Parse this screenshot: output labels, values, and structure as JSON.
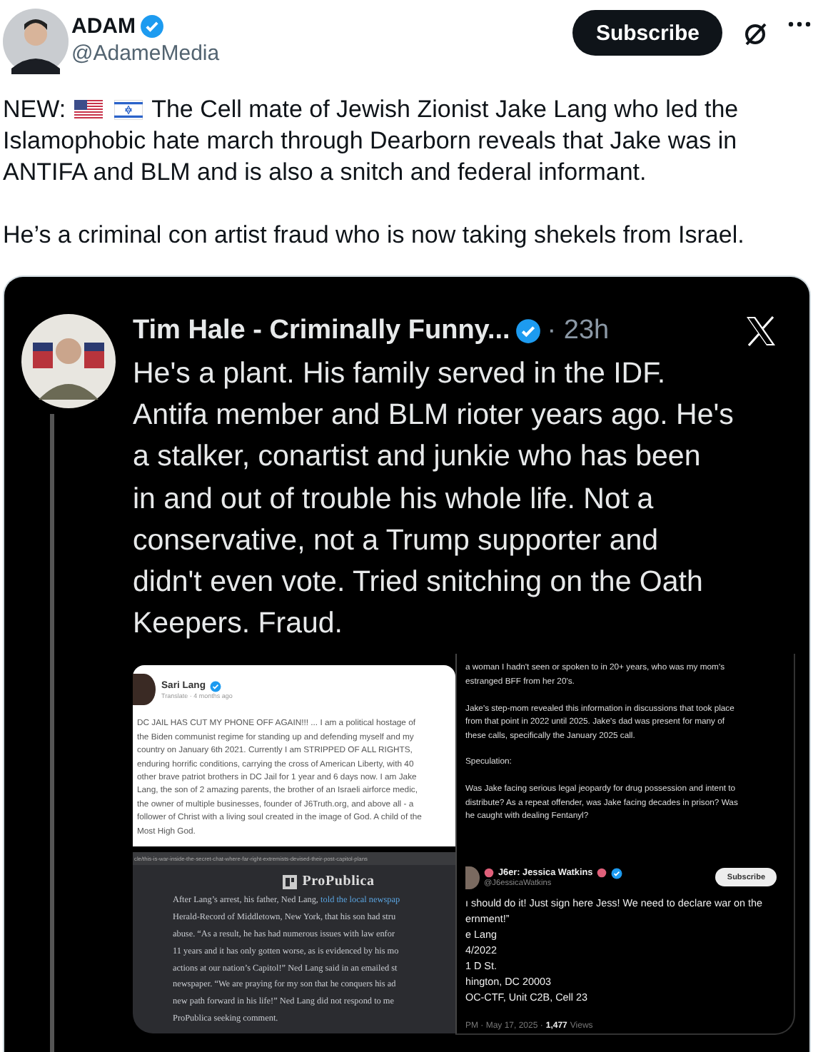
{
  "post": {
    "author": {
      "name": "ADAM",
      "handle": "@AdameMedia",
      "verified": true
    },
    "subscribe_label": "Subscribe",
    "intro": {
      "lead": "NEW:",
      "first_line": "The Cell mate of Jewish Zionist Jake Lang who led the",
      "text": "Islamophobic hate march through Dearborn reveals that Jake was in ANTIFA and BLM and is also a snitch and federal informant."
    },
    "paragraph": "He’s a criminal con artist fraud who is now taking shekels from Israel."
  },
  "media": {
    "quoted": {
      "name": "Tim Hale - Criminally Funny...",
      "verified": true,
      "time": "· 23h",
      "lines": [
        "He's a plant. His family served in the IDF.",
        "Antifa member and BLM rioter years ago. He's",
        "a stalker, conartist and junkie who has been",
        "in and out of trouble his whole life. Not a",
        "conservative, not a Trump supporter and",
        "didn't even vote. Tried snitching on the Oath",
        "Keepers. Fraud."
      ]
    },
    "facebook_post": {
      "name": "Sari Lang",
      "verified": true,
      "meta": "Translate · 4 months ago",
      "lines": [
        "DC JAIL HAS CUT MY PHONE OFF AGAIN!!! ... I am a political hostage of",
        "the Biden communist regime for standing up and defending myself and my",
        "country on January 6th 2021. Currently I am STRIPPED OF ALL RIGHTS,",
        "enduring horrific conditions, carrying the cross of American Liberty, with 40",
        "other brave patriot brothers in DC Jail for 1 year and 6 days now. I am Jake",
        "Lang, the son of 2 amazing parents, the brother of an Israeli airforce medic,",
        "the owner of multiple businesses, founder of J6Truth.org, and above all - a",
        "follower of Christ with a living soul created in the image of God. A child of the",
        "Most High God."
      ]
    },
    "url_caption": "cle/this-is-war-inside-the-secret-chat-where-far-right-extremists-devised-their-post-capitol-plans",
    "article": {
      "brand": "ProPublica",
      "lines": [
        {
          "text": "After Lang’s arrest, his father, Ned Lang, ",
          "link": "told the local newspap"
        },
        {
          "text": "Herald-Record of Middletown, New York, that his son had stru"
        },
        {
          "text": "abuse. “As a result, he has had numerous issues with law enfor"
        },
        {
          "text": "11 years and it has only gotten worse, as is evidenced by his mo"
        },
        {
          "text": "actions at our nation’s Capitol!” Ned Lang said in an emailed st"
        },
        {
          "text": "newspaper. “We are praying for my son that he conquers his ad"
        },
        {
          "text": "new path forward in his life!” Ned Lang did not respond to me"
        },
        {
          "text": "ProPublica seeking comment."
        }
      ]
    },
    "notes": {
      "paragraphs": [
        [
          "a woman I hadn't seen or spoken to in 20+ years, who was my mom's",
          "estranged BFF from her 20's."
        ],
        [
          "Jake's step-mom revealed this information in discussions that took place",
          "from that point in 2022 until 2025. Jake's dad was present for many of",
          "these calls, specifically the January 2025 call."
        ],
        [
          "Speculation:"
        ],
        [
          "Was Jake facing serious legal jeopardy for drug possession and intent to",
          "distribute? As a repeat offender, was Jake facing decades in prison? Was",
          "he caught with dealing Fentanyl?"
        ]
      ]
    },
    "embedded_post": {
      "name": "J6er: Jessica Watkins",
      "verified": true,
      "handle": "@J6essicaWatkins",
      "subscribe_label": "Subscribe",
      "lines": [
        "ı should do it! Just sign here Jess! We need to declare war on the",
        "ernment!”",
        "e Lang",
        "4/2022",
        "1 D St.",
        "hington, DC 20003",
        "OC-CTF, Unit C2B, Cell 23"
      ],
      "time": "PM · May 17, 2025 ·",
      "views": "1,477",
      "views_label": "Views"
    }
  }
}
